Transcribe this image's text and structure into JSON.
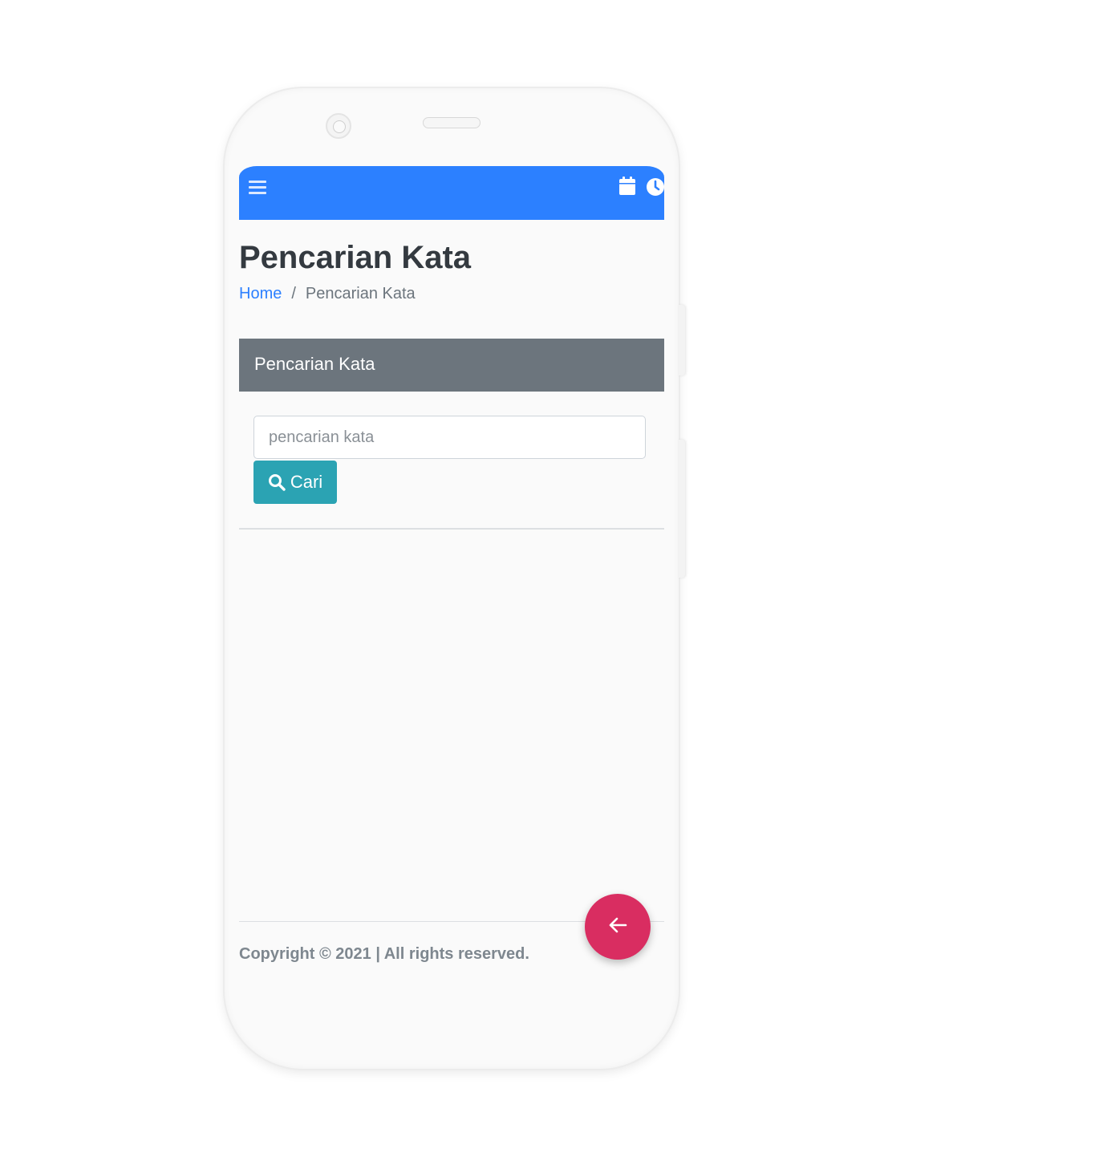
{
  "navbar": {
    "background_color": "#2c80ff",
    "menu_icon": "hamburger-icon",
    "right_icons": [
      "calendar-icon",
      "clock-icon"
    ]
  },
  "page": {
    "title": "Pencarian Kata"
  },
  "breadcrumb": {
    "home_label": "Home",
    "separator": "/",
    "current_label": "Pencarian Kata"
  },
  "card": {
    "header_title": "Pencarian Kata",
    "header_color": "#6c757d"
  },
  "search": {
    "value": "",
    "placeholder": "pencarian kata",
    "button_label": "Cari",
    "button_icon": "search-icon",
    "button_color": "#2ba3b3"
  },
  "footer": {
    "copyright": "Copyright © 2021 | All rights reserved."
  },
  "fab": {
    "icon": "arrow-left-icon",
    "color": "#d92d61"
  }
}
